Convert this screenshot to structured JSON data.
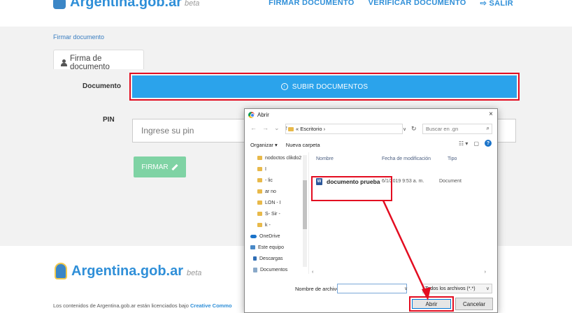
{
  "header": {
    "brand": "Argentina.gob.ar",
    "beta": "beta",
    "nav": [
      "FIRMAR DOCUMENTO",
      "VERIFICAR DOCUMENTO",
      "⇨ SALIR"
    ]
  },
  "breadcrumb": "Firmar documento",
  "tab": {
    "label": "Firma de documento"
  },
  "form": {
    "document_label": "Documento",
    "upload_label": "SUBIR DOCUMENTOS",
    "pin_label": "PIN",
    "pin_placeholder": "Ingrese su pin",
    "sign_label": "FIRMAR"
  },
  "footer": {
    "brand": "Argentina.gob.ar",
    "beta": "beta",
    "text": "Los contenidos de Argentina.gob.ar están licenciados bajo ",
    "link": "Creative Commo"
  },
  "dialog": {
    "title": "Abrir",
    "close": "×",
    "address": "« Escritorio ›",
    "search_placeholder": "Buscar en .gn",
    "organize": "Organizar ▾",
    "new_folder": "Nueva carpeta",
    "nav_items": [
      "nodoctos clikdo2",
      "I",
      "- lic",
      "ar no",
      "LON - I",
      "S- Sir -",
      "k -",
      "OneDrive",
      "Este equipo",
      "Descargas",
      "Documentos"
    ],
    "columns": {
      "name": "Nombre",
      "date": "Fecha de modificación",
      "type": "Tipo"
    },
    "file": {
      "name": "documento prueba",
      "date": "6/1/2019 9:53 a. m.",
      "type": "Document"
    },
    "filename_label": "Nombre de archivo:",
    "filename_value": "",
    "filter": "Todos los archivos (*.*)",
    "open": "Abrir",
    "cancel": "Cancelar"
  },
  "colors": {
    "accent": "#2ba3eb",
    "highlight": "#e30c20",
    "sign": "#7fd3a4",
    "brand": "#2f8fd8"
  }
}
